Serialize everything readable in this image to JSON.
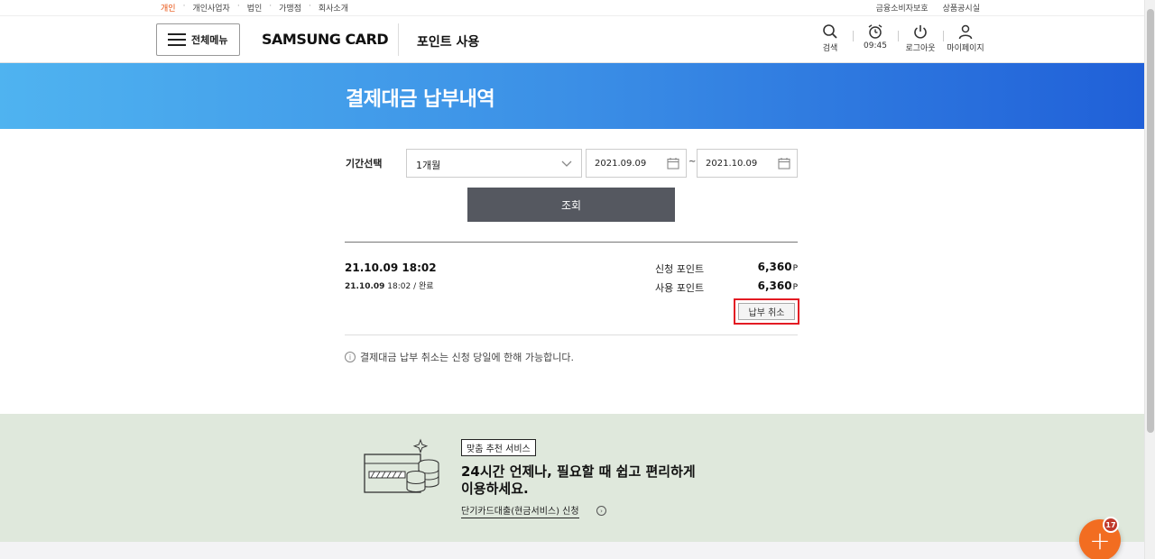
{
  "util_bar": {
    "left_items": [
      "개인",
      "개인사업자",
      "법인",
      "가맹점",
      "회사소개"
    ],
    "active_index": 0,
    "right_items": [
      "금융소비자보호",
      "상품공시실"
    ]
  },
  "header": {
    "menu_label": "전체메뉴",
    "logo_text": "SAMSUNG CARD",
    "page_name": "포인트 사용",
    "icons": {
      "search_label": "검색",
      "timer_label": "09:45",
      "logout_label": "로그아웃",
      "mypage_label": "마이페이지"
    }
  },
  "hero": {
    "title": "결제대금 납부내역"
  },
  "filter": {
    "label": "기간선택",
    "period_value": "1개월",
    "date_from": "2021.09.09",
    "date_separator": "~",
    "date_to": "2021.10.09",
    "search_label": "조회"
  },
  "result": {
    "datetime": "21.10.09  18:02",
    "sub_date": "21.10.09",
    "sub_rest": " 18:02 / 완료",
    "requested_label": "신청 포인트",
    "requested_value": "6,360",
    "used_label": "사용 포인트",
    "used_value": "6,360",
    "unit": "P",
    "cancel_label": "납부 취소"
  },
  "notice": {
    "icon": "i",
    "text": "결제대금 납부 취소는 신청 당일에 한해 가능합니다."
  },
  "reco": {
    "tag": "맞춤 추천 서비스",
    "title_line1": "24시간 언제나, 필요할 때 쉽고 편리하게",
    "title_line2": "이용하세요.",
    "link_text": "단기카드대출(현금서비스) 신청",
    "link_icon": "›"
  },
  "fab": {
    "symbol": "+",
    "badge": "17"
  },
  "colors": {
    "accent": "#e8500e",
    "hero_start": "#4fb3f0",
    "hero_end": "#2060d8",
    "highlight": "#e31b23",
    "fab": "#f26d21",
    "reco_bg": "#dfe8dc"
  }
}
